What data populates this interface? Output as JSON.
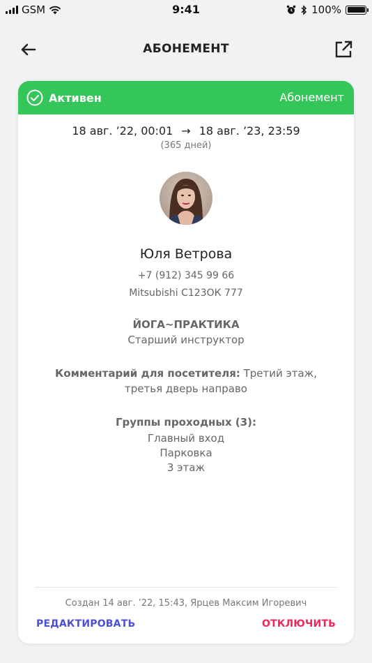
{
  "status_bar": {
    "carrier": "GSM",
    "time": "9:41",
    "battery": "100%"
  },
  "nav": {
    "title": "АБОНЕМЕНТ",
    "back_icon": "arrow-left-icon",
    "share_icon": "share-external-icon"
  },
  "card": {
    "status": "Активен",
    "type": "Абонемент",
    "accent_color": "#35c65a",
    "period": {
      "start": "18 авг. ’22, 00:01",
      "end": "18 авг. ’23, 23:59",
      "arrow": "→",
      "duration": "(365 дней)"
    },
    "person": {
      "name": "Юля Ветрова",
      "phone": "+7 (912) 345 99 66",
      "vehicle": "Mitsubishi С123ОК 777"
    },
    "organization": "ЙОГА~ПРАКТИКА",
    "role": "Старший инструктор",
    "comment": {
      "label": "Комментарий для посетителя:",
      "text": "Третий этаж, третья дверь направо"
    },
    "groups": {
      "title": "Группы проходных (3):",
      "items": [
        "Главный вход",
        "Парковка",
        "3 этаж"
      ]
    },
    "created": "Создан 14 авг. ’22, 15:43, Ярцев Максим Игоревич",
    "actions": {
      "edit": "РЕДАКТИРОВАТЬ",
      "disable": "ОТКЛЮЧИТЬ"
    }
  }
}
